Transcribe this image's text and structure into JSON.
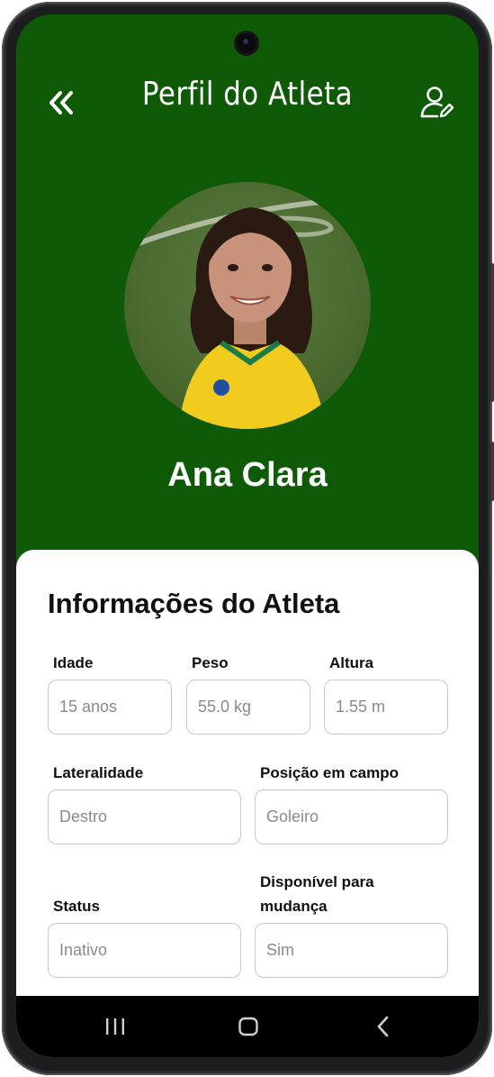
{
  "header": {
    "title": "Perfil do Atleta",
    "back_icon": "double-chevron-left-icon",
    "edit_icon": "user-edit-icon",
    "background_color": "#0e5a06"
  },
  "athlete": {
    "name": "Ana Clara",
    "photo": "athlete-photo"
  },
  "info": {
    "section_title": "Informações do Atleta",
    "fields": {
      "idade": {
        "label": "Idade",
        "value": "15 anos"
      },
      "peso": {
        "label": "Peso",
        "value": "55.0 kg"
      },
      "altura": {
        "label": "Altura",
        "value": "1.55 m"
      },
      "lateralidade": {
        "label": "Lateralidade",
        "value": "Destro"
      },
      "posicao": {
        "label": "Posição em campo",
        "value": "Goleiro"
      },
      "status": {
        "label": "Status",
        "value": "Inativo"
      },
      "disponivel": {
        "label_line1": "Disponível para",
        "label_line2": "mudança",
        "value": "Sim"
      }
    }
  },
  "navbar": {
    "items": [
      "recent-apps-icon",
      "home-icon",
      "back-icon"
    ]
  }
}
